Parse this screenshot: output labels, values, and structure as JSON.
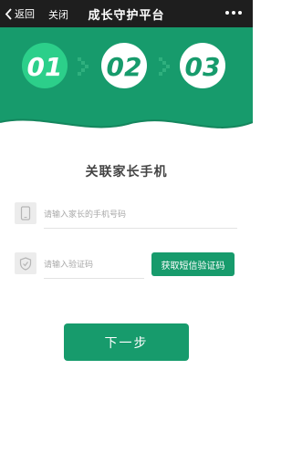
{
  "topbar": {
    "back_label": "返回",
    "close_label": "关闭",
    "title": "成长守护平台"
  },
  "steps": [
    "01",
    "02",
    "03"
  ],
  "form": {
    "heading": "关联家长手机",
    "phone_placeholder": "请输入家长的手机号码",
    "code_placeholder": "请输入验证码",
    "sms_button": "获取短信验证码",
    "next_button": "下一步"
  },
  "colors": {
    "brand": "#179b6c",
    "step_active": "#2ccf8a",
    "topbar": "#1e1e1e"
  }
}
